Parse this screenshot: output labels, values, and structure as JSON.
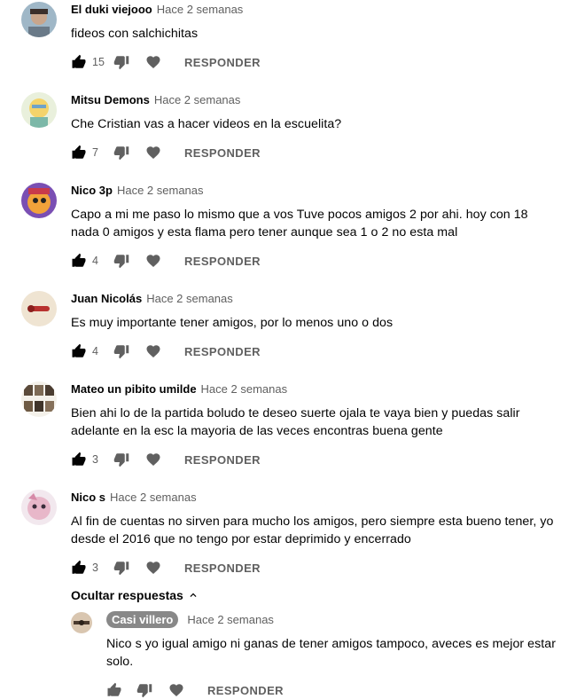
{
  "comments": [
    {
      "author": "El duki viejooo",
      "time": "Hace 2 semanas",
      "text": "fideos con salchichitas",
      "likes": "15",
      "reply_label": "RESPONDER"
    },
    {
      "author": "Mitsu Demons",
      "time": "Hace 2 semanas",
      "text": "Che Cristian vas a hacer videos en la escuelita?",
      "likes": "7",
      "reply_label": "RESPONDER"
    },
    {
      "author": "Nico 3p",
      "time": "Hace 2 semanas",
      "text": "Capo a mi me paso lo mismo que a vos Tuve pocos amigos 2 por ahi.  hoy con 18 nada 0 amigos y esta flama pero tener aunque sea 1 o 2 no esta mal",
      "likes": "4",
      "reply_label": "RESPONDER"
    },
    {
      "author": "Juan Nicolás",
      "time": "Hace 2 semanas",
      "text": "Es muy importante tener amigos, por lo menos uno o dos",
      "likes": "4",
      "reply_label": "RESPONDER"
    },
    {
      "author": "Mateo un pibito umilde",
      "time": "Hace 2 semanas",
      "text": "Bien ahi lo de la partida boludo te deseo suerte ojala te vaya bien y puedas salir adelante en la esc la mayoria de las veces encontras buena gente",
      "likes": "3",
      "reply_label": "RESPONDER"
    },
    {
      "author": "Nico s",
      "time": "Hace 2 semanas",
      "text": "Al fin de cuentas no sirven para mucho los amigos, pero siempre esta bueno tener, yo desde el 2016 que no tengo por estar deprimido y encerrado",
      "likes": "3",
      "reply_label": "RESPONDER"
    }
  ],
  "hide_replies_label": "Ocultar respuestas",
  "reply": {
    "author": "Casi villero",
    "time": "Hace 2 semanas",
    "text": "Nico s yo igual amigo ni ganas de tener amigos tampoco, aveces es mejor estar solo.",
    "reply_label": "RESPONDER"
  },
  "colors": {
    "text": "#030303",
    "meta": "#606060",
    "icon": "#606060",
    "icon_active": "#030303",
    "owner_badge": "#888888"
  },
  "icons": {
    "like": "thumbs-up-icon",
    "dislike": "thumbs-down-icon",
    "heart": "heart-icon",
    "chevron": "chevron-up-icon"
  }
}
